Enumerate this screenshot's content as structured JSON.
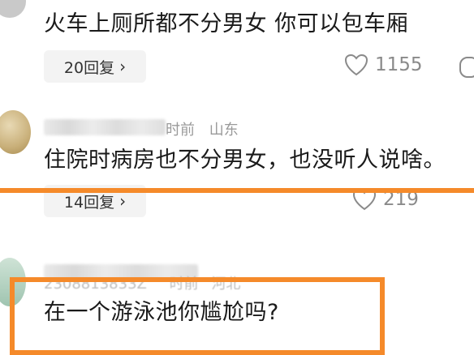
{
  "comments": [
    {
      "text": "火车上厕所都不分男女 你可以包车厢",
      "replies_label": "20回复",
      "likes": "1155"
    },
    {
      "time": "时前",
      "location": "山东",
      "text": "住院时病房也不分男女，也没听人说啥。",
      "replies_label": "14回复",
      "likes": "219"
    },
    {
      "username_partial": "2308813833Z",
      "time": "时前",
      "location": "河北",
      "text": "在一个游泳池你尴尬吗?"
    }
  ],
  "colors": {
    "highlight": "#f58a2a",
    "meta": "#9a9a9a",
    "pill_bg": "#f3f3f3"
  },
  "icons": [
    "chevron-right-icon",
    "heart-icon",
    "dislike-icon"
  ]
}
